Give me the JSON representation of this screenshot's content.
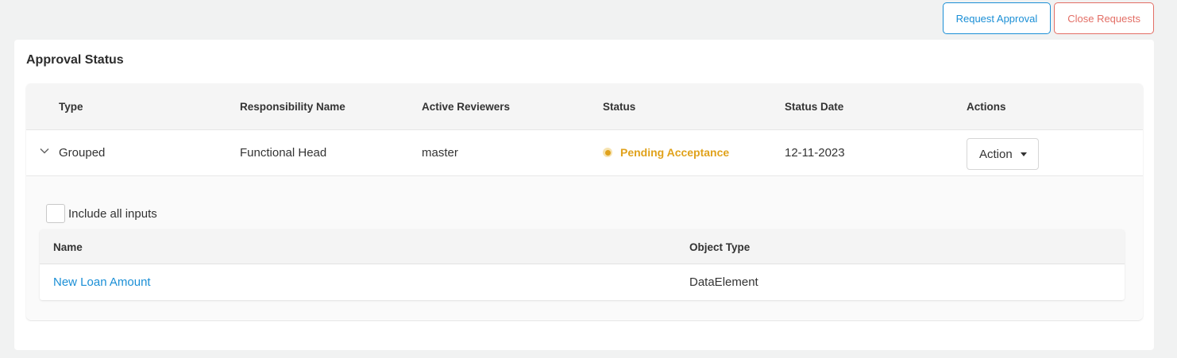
{
  "toolbar": {
    "request_approval": "Request Approval",
    "close_requests": "Close Requests"
  },
  "card": {
    "title": "Approval Status"
  },
  "table": {
    "headers": [
      "Type",
      "Responsibility Name",
      "Active Reviewers",
      "Status",
      "Status Date",
      "Actions"
    ],
    "row": {
      "type": "Grouped",
      "responsibility": "Functional Head",
      "reviewers": "master",
      "status": "Pending Acceptance",
      "status_date": "12-11-2023",
      "action_label": "Action"
    }
  },
  "expanded": {
    "include_label": "Include all inputs",
    "headers": [
      "Name",
      "Object Type"
    ],
    "rows": [
      {
        "name": "New Loan Amount",
        "object_type": "DataElement"
      }
    ]
  },
  "colors": {
    "accent": "#1b8fd6",
    "danger": "#e36e65",
    "pending": "#e0a21c"
  },
  "icons": [
    "chevron-down-icon",
    "status-dot-icon",
    "caret-down-icon"
  ]
}
